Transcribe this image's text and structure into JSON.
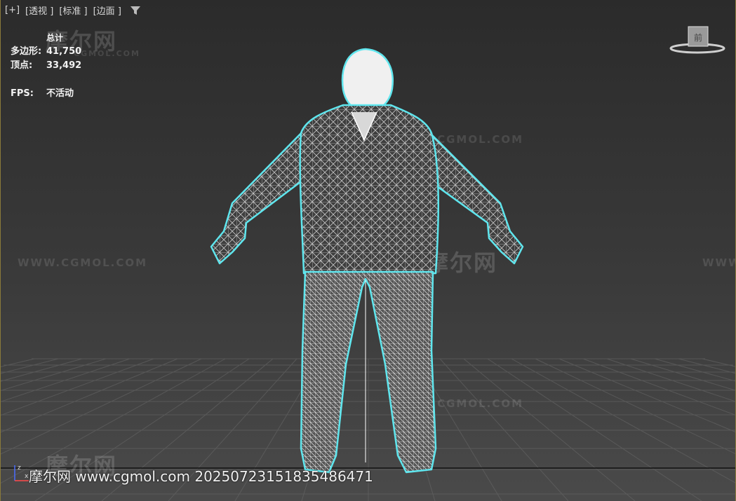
{
  "menu": {
    "plus": "[+]",
    "view": "[透视 ]",
    "shading": "[标准 ]",
    "edges": "[边面 ]"
  },
  "stats": {
    "total_label": "总计",
    "polygons_label": "多边形:",
    "polygons_value": "41,750",
    "vertices_label": "顶点:",
    "vertices_value": "33,492",
    "fps_label": "FPS:",
    "fps_value": "不活动"
  },
  "watermark": {
    "brand": "摩尔网",
    "url_caps": "WWW.CGMOL.COM",
    "url_small": "CGMOL.COM"
  },
  "bottom_line": "摩尔网 www.cgmol.com 20250723151835486471",
  "viewcube_label": "前",
  "axis": {
    "x": "x",
    "z": "z"
  },
  "colors": {
    "selection_outline": "#5fe6ee",
    "wire": "#ffffff",
    "grid": "#6a6a6a"
  }
}
